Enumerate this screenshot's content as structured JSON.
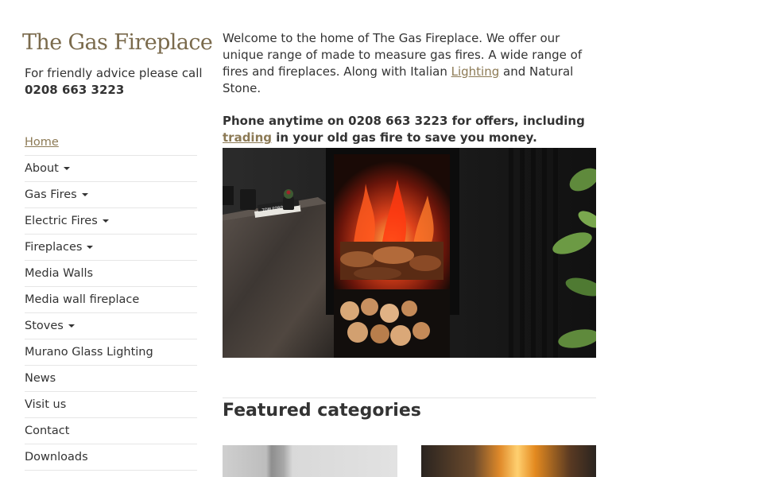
{
  "site": {
    "logo": "The Gas Fireplace",
    "advice_line": "For friendly advice please call",
    "phone": "0208 663 3223"
  },
  "nav": {
    "items": [
      {
        "label": "Home",
        "dropdown": false,
        "active": true
      },
      {
        "label": "About",
        "dropdown": true
      },
      {
        "label": "Gas Fires",
        "dropdown": true
      },
      {
        "label": "Electric Fires",
        "dropdown": true
      },
      {
        "label": "Fireplaces",
        "dropdown": true
      },
      {
        "label": "Media Walls",
        "dropdown": false
      },
      {
        "label": "Media wall fireplace",
        "dropdown": false
      },
      {
        "label": "Stoves",
        "dropdown": true
      },
      {
        "label": "Murano Glass Lighting",
        "dropdown": false
      },
      {
        "label": "News",
        "dropdown": false
      },
      {
        "label": "Visit us",
        "dropdown": false
      },
      {
        "label": "Contact",
        "dropdown": false
      },
      {
        "label": "Downloads",
        "dropdown": false
      }
    ]
  },
  "main": {
    "intro_before": "Welcome to the home of The Gas Fireplace. We offer our unique range of made to measure gas fires. A wide range of fires and fireplaces. Along with Italian ",
    "intro_link": "Lighting",
    "intro_after": " and Natural Stone.",
    "offer_before": "Phone anytime on 0208 663 3223 for offers, including ",
    "offer_link": "trading",
    "offer_after": " in your old gas fire to save you money.",
    "book_spine": "TOM FORD",
    "featured_title": "Featured categories"
  },
  "colors": {
    "accent": "#8c7a55",
    "logo": "#7a6a4c",
    "text": "#333333"
  }
}
